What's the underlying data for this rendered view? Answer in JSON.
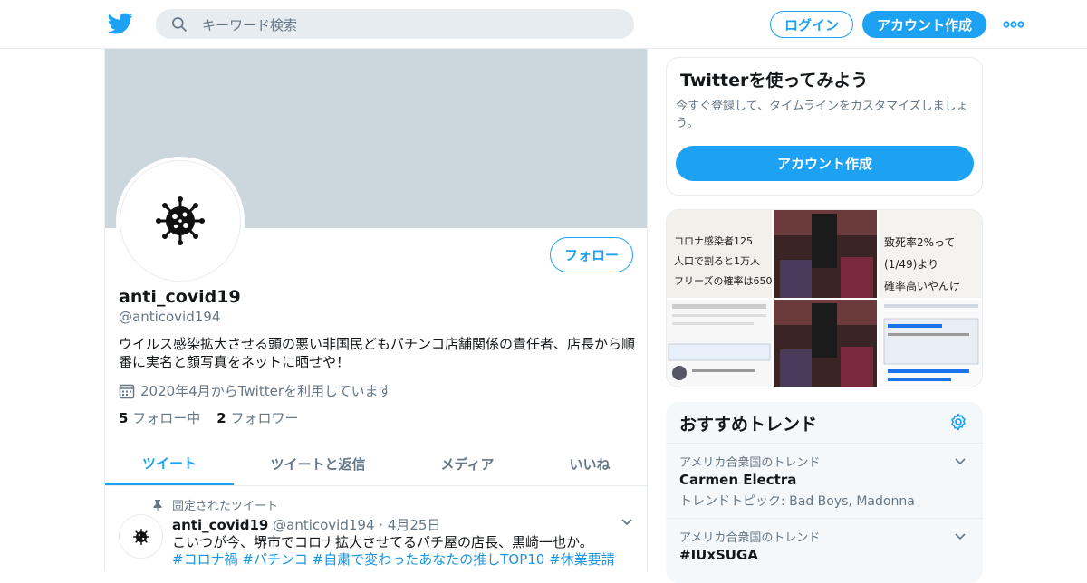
{
  "header": {
    "search_placeholder": "キーワード検索",
    "login_label": "ログイン",
    "signup_label": "アカウント作成",
    "brand_color": "#1da1f2"
  },
  "profile": {
    "name": "anti_covid19",
    "handle": "@anticovid194",
    "bio": "ウイルス感染拡大させる頭の悪い非国民どもパチンコ店舗関係の責任者、店長から順番に実名と顔写真をネットに晒せや！",
    "joined": "2020年4月からTwitterを利用しています",
    "following_count": "5",
    "following_label": "フォロー中",
    "followers_count": "2",
    "followers_label": "フォロワー",
    "follow_button": "フォロー",
    "avatar_icon": "virus-icon"
  },
  "tabs": [
    {
      "label": "ツイート",
      "active": true
    },
    {
      "label": "ツイートと返信",
      "active": false
    },
    {
      "label": "メディア",
      "active": false
    },
    {
      "label": "いいね",
      "active": false
    }
  ],
  "pinned_tweet": {
    "pinned_label": "固定されたツイート",
    "author_name": "anti_covid19",
    "author_handle": "@anticovid194",
    "separator": "·",
    "date": "4月25日",
    "text": "こいつが今、堺市でコロナ拡大させてるパチ屋の店長、黒崎一也か。",
    "hashtags": "#コロナ禍 #パチンコ #自粛で変わったあなたの推しTOP10 #休業要請"
  },
  "signup_card": {
    "title": "Twitterを使ってみよう",
    "description": "今すぐ登録して、タイムラインをカスタマイズしましょう。",
    "button": "アカウント作成"
  },
  "media_grid": {
    "note1": "コロナ感染者125人口で割ると1万人フリーズの確率は650",
    "note2": "致死率2%って(1/49)より確率高いやんけ"
  },
  "trends": {
    "title": "おすすめトレンド",
    "items": [
      {
        "context": "アメリカ合衆国のトレンド",
        "name": "Carmen Electra",
        "subtitle": "トレンドトピック: Bad Boys, Madonna"
      },
      {
        "context": "アメリカ合衆国のトレンド",
        "name": "#IUxSUGA",
        "subtitle": ""
      }
    ]
  }
}
